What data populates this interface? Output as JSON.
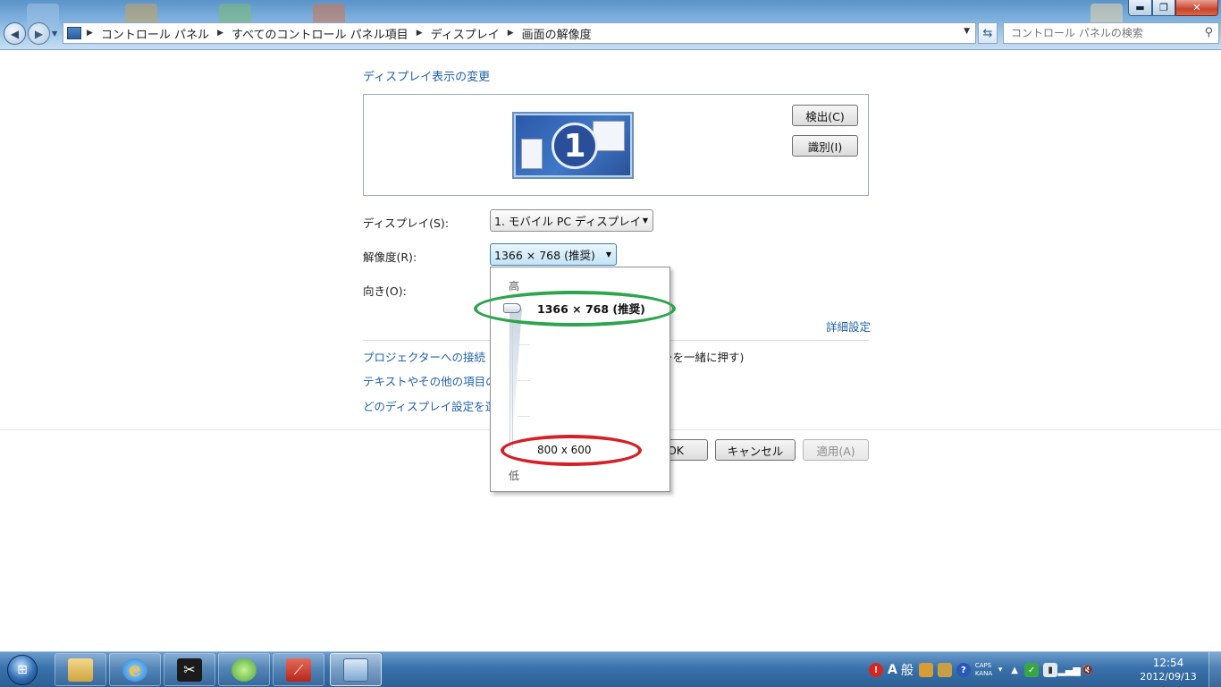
{
  "window": {
    "minimize_glyph": "▬",
    "maximize_glyph": "❐",
    "close_glyph": "✕"
  },
  "address": {
    "breadcrumbs": [
      "コントロール パネル",
      "すべてのコントロール パネル項目",
      "ディスプレイ",
      "画面の解像度"
    ],
    "search_placeholder": "コントロール パネルの検索"
  },
  "page": {
    "heading": "ディスプレイ表示の変更",
    "monitor_number": "1",
    "detect_button": "検出(C)",
    "identify_button": "識別(I)",
    "display_label": "ディスプレイ(S):",
    "display_value": "1. モバイル PC ディスプレイ",
    "resolution_label": "解像度(R):",
    "resolution_value": "1366 × 768 (推奨)",
    "orientation_label": "向き(O):",
    "advanced_link": "詳細設定",
    "projector_link": "プロジェクターへの接続",
    "projector_link_tail": "(",
    "projector_suffix": "ーを一緒に押す)",
    "text_size_link": "テキストやその他の項目の",
    "which_display_link": "どのディスプレイ設定を選",
    "ok_button": "OK",
    "cancel_button": "キャンセル",
    "apply_button": "適用(A)"
  },
  "resolution_dropdown": {
    "high_label": "高",
    "low_label": "低",
    "highest_option": "1366 × 768 (推奨)",
    "lowest_option": "800 x 600",
    "selected_fraction": 1.0
  },
  "annotations": {
    "highlight_high_color": "#2ea44f",
    "highlight_low_color": "#d42027"
  },
  "taskbar": {
    "pinned": [
      "explorer-icon",
      "internet-explorer-icon",
      "tools-icon",
      "messenger-icon",
      "app-icon",
      "display-settings-icon"
    ],
    "ime_mode": "A",
    "ime_kanji": "般",
    "caps_label": "CAPS",
    "kana_label": "KANA",
    "time": "12:54",
    "date": "2012/09/13"
  }
}
